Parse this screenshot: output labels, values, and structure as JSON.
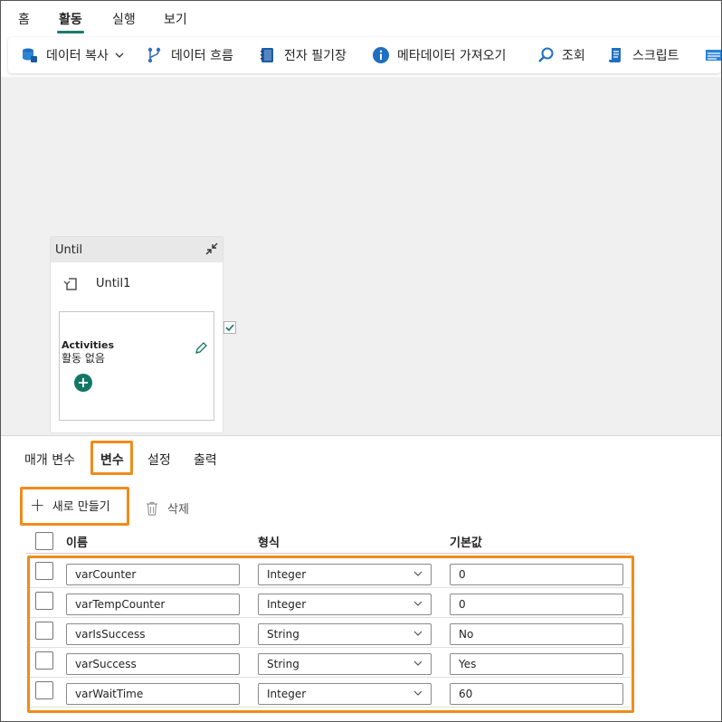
{
  "menu": {
    "items": [
      {
        "label": "홈",
        "active": false
      },
      {
        "label": "활동",
        "active": true
      },
      {
        "label": "실행",
        "active": false
      },
      {
        "label": "보기",
        "active": false
      }
    ]
  },
  "toolbar": {
    "items": [
      {
        "label": "데이터 복사",
        "icon": "database-copy-icon",
        "has_dropdown": true
      },
      {
        "label": "데이터 흐름",
        "icon": "dataflow-icon"
      },
      {
        "label": "전자 필기장",
        "icon": "notebook-icon"
      },
      {
        "label": "메타데이터 가져오기",
        "icon": "info-icon"
      },
      {
        "label": "조회",
        "icon": "lookup-icon"
      },
      {
        "label": "스크립트",
        "icon": "script-icon"
      }
    ]
  },
  "canvas": {
    "until_card": {
      "header": "Until",
      "name": "Until1",
      "activities_title": "Activities",
      "activities_empty": "활동 없음"
    }
  },
  "panel": {
    "tabs": [
      {
        "label": "매개 변수",
        "active": false
      },
      {
        "label": "변수",
        "active": true
      },
      {
        "label": "설정",
        "active": false
      },
      {
        "label": "출력",
        "active": false
      }
    ],
    "new_label": "새로 만들기",
    "delete_label": "삭제",
    "columns": {
      "name": "이름",
      "type": "형식",
      "default": "기본값"
    },
    "rows": [
      {
        "name": "varCounter",
        "type": "Integer",
        "default": "0"
      },
      {
        "name": "varTempCounter",
        "type": "Integer",
        "default": "0"
      },
      {
        "name": "varIsSuccess",
        "type": "String",
        "default": "No"
      },
      {
        "name": "varSuccess",
        "type": "String",
        "default": "Yes"
      },
      {
        "name": "varWaitTime",
        "type": "Integer",
        "default": "60"
      }
    ]
  },
  "colors": {
    "accent": "#117865",
    "highlight": "#f08c1a",
    "canvas_bg": "#f0f0f0"
  }
}
